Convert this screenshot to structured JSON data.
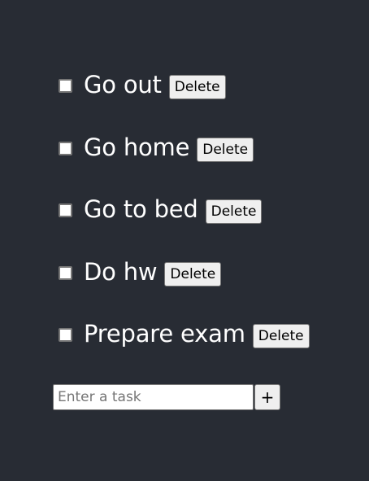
{
  "colors": {
    "background": "#282c34",
    "text": "#ffffff",
    "button_bg": "#efefef",
    "border": "#767676"
  },
  "tasks": [
    {
      "label": "Go out",
      "checked": false,
      "delete_label": "Delete"
    },
    {
      "label": "Go home",
      "checked": false,
      "delete_label": "Delete"
    },
    {
      "label": "Go to bed",
      "checked": false,
      "delete_label": "Delete"
    },
    {
      "label": "Do hw",
      "checked": false,
      "delete_label": "Delete"
    },
    {
      "label": "Prepare exam",
      "checked": false,
      "delete_label": "Delete"
    }
  ],
  "add_form": {
    "input_value": "",
    "input_placeholder": "Enter a task",
    "add_label": "+"
  }
}
